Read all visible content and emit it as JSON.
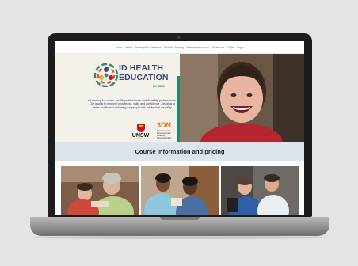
{
  "nav": {
    "items": [
      "Home",
      "About",
      "Subscription Packages",
      "Bespoke Training",
      "Acknowledgements",
      "Contact Us",
      "FAQs",
      "Log in"
    ]
  },
  "hero": {
    "logo_line1": "ID HEALTH",
    "logo_line2": "EDUCATION",
    "logo_by": "BY 3DN",
    "tagline": "e-Learning for carers, health professionals and disability professionals. Our goal is to improve knowledge, skills and confidence – leading to better health and wellbeing for people with intellectual disability.",
    "unsw_name": "UNSW",
    "unsw_sub": "SYDNEY",
    "dept_logo": "3DN",
    "dept_name": "Department of Developmental Disability Neuropsychiatry"
  },
  "section": {
    "title": "Course information and pricing"
  },
  "colors": {
    "navy": "#3c4a74",
    "teal": "#1e8a6e",
    "hero_bg": "#f3f1e9",
    "section_bg": "#dbe6ea"
  },
  "icons": [
    "logo-mark-icon",
    "unsw-shield-icon"
  ]
}
